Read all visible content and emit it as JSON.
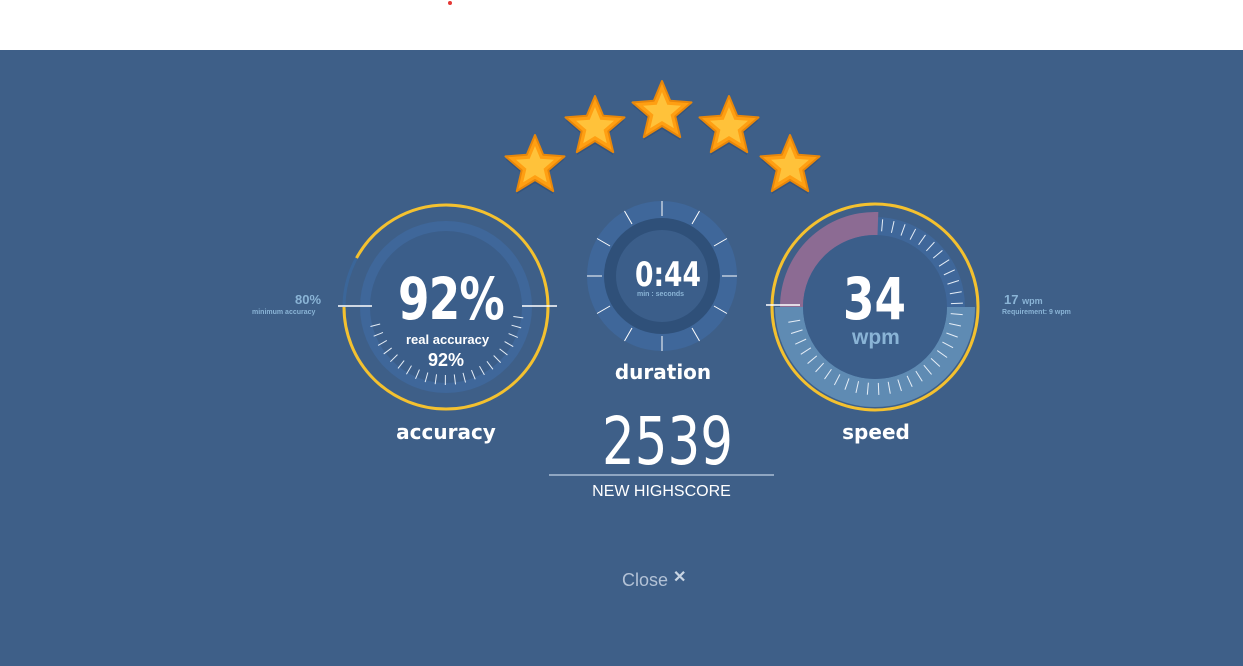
{
  "rating": {
    "stars_filled": 5,
    "stars_total": 5
  },
  "accuracy": {
    "value": "92%",
    "fraction": 0.92,
    "real_label": "real accuracy",
    "real_value": "92%",
    "min_value": "80%",
    "min_label": "minimum accuracy",
    "label": "accuracy"
  },
  "duration": {
    "value": "0:44",
    "unit": "min : seconds",
    "label": "duration"
  },
  "speed": {
    "value": "34",
    "unit": "wpm",
    "side_value": "17",
    "side_unit": "wpm",
    "requirement": "Requirement: 9 wpm",
    "label": "speed"
  },
  "score": {
    "value": "2539",
    "caption": "NEW HIGHSCORE"
  },
  "close": {
    "label": "Close",
    "icon": "close-icon"
  },
  "colors": {
    "background": "#3e5f88",
    "gauge_ring": "#f4c12f",
    "star": "#ffaa1a",
    "speed_fill": "#5f8bb3",
    "speed_warn": "#8c6b93",
    "muted_text": "#8ab4d6"
  }
}
